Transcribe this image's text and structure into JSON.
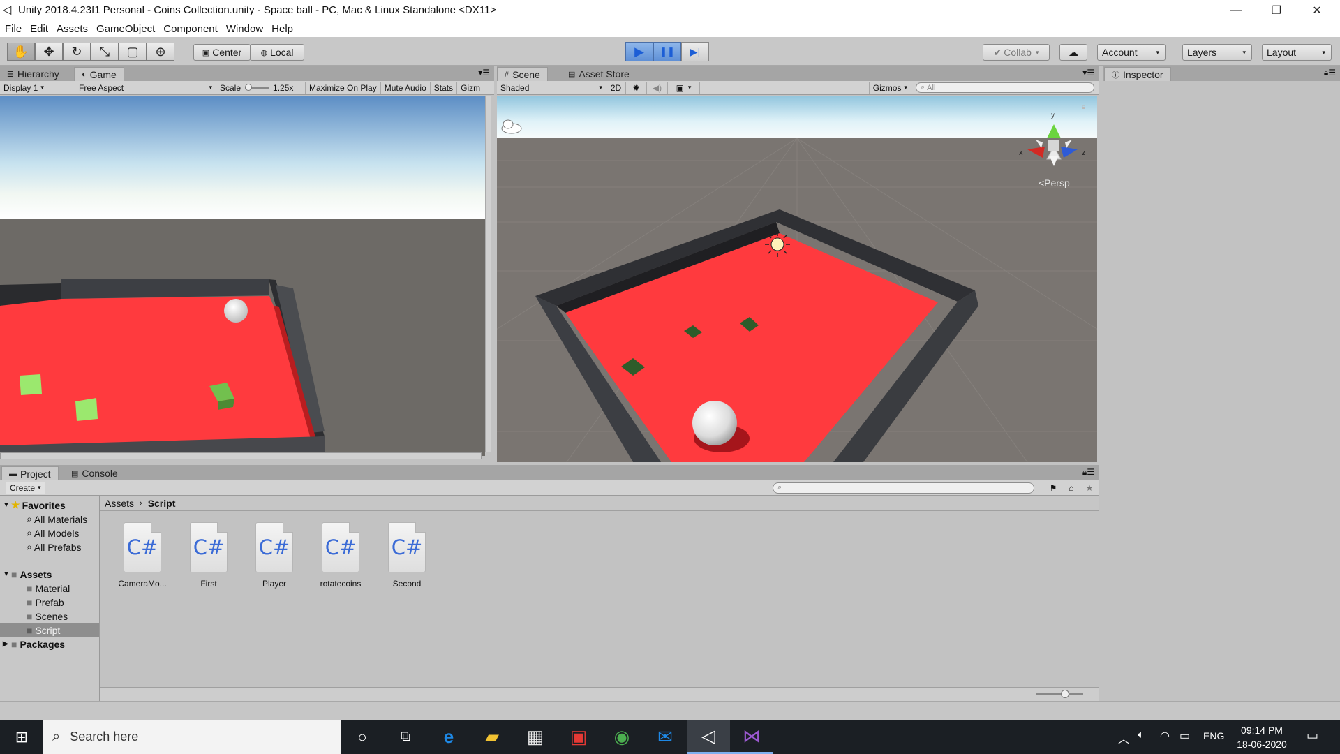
{
  "window": {
    "title": "Unity 2018.4.23f1 Personal - Coins Collection.unity - Space ball - PC, Mac & Linux Standalone <DX11>",
    "min": "—",
    "max": "❐",
    "close": "✕"
  },
  "menu": [
    "File",
    "Edit",
    "Assets",
    "GameObject",
    "Component",
    "Window",
    "Help"
  ],
  "toolbar": {
    "tools": [
      "hand-icon",
      "move-icon",
      "rotate-icon",
      "scale-icon",
      "rect-icon",
      "transform-icon"
    ],
    "tool_glyphs": [
      "✋",
      "✥",
      "↻",
      "⤡",
      "▢",
      "⊕"
    ],
    "pivot": "Center",
    "space": "Local",
    "play_glyph": "▶",
    "pause_glyph": "❚❚",
    "step_glyph": "▶|",
    "collab": "Collab",
    "cloud_glyph": "☁",
    "account": "Account",
    "layers": "Layers",
    "layout": "Layout"
  },
  "left_panel": {
    "tabs": [
      "Hierarchy",
      "Game"
    ],
    "display": "Display 1",
    "aspect": "Free Aspect",
    "scale_label": "Scale",
    "scale_value": "1.25x",
    "maximize": "Maximize On Play",
    "mute": "Mute Audio",
    "stats": "Stats",
    "gizmos_cut": "Gizm"
  },
  "scene_panel": {
    "tabs": [
      "Scene",
      "Asset Store"
    ],
    "shading": "Shaded",
    "mode2d": "2D",
    "gizmos": "Gizmos",
    "search_placeholder": "All",
    "persp": "<Persp",
    "axis_x": "x",
    "axis_y": "y",
    "axis_z": "z"
  },
  "inspector": {
    "tab": "Inspector"
  },
  "project": {
    "tabs": [
      "Project",
      "Console"
    ],
    "create": "Create",
    "favorites": "Favorites",
    "fav_items": [
      "All Materials",
      "All Models",
      "All Prefabs"
    ],
    "assets_root": "Assets",
    "folders": [
      "Material",
      "Prefab",
      "Scenes",
      "Script"
    ],
    "selected_folder": "Script",
    "packages": "Packages",
    "breadcrumb": [
      "Assets",
      "Script"
    ],
    "files": [
      {
        "icon": "C#",
        "name": "CameraMo..."
      },
      {
        "icon": "C#",
        "name": "First"
      },
      {
        "icon": "C#",
        "name": "Player"
      },
      {
        "icon": "C#",
        "name": "rotatecoins"
      },
      {
        "icon": "C#",
        "name": "Second"
      }
    ]
  },
  "taskbar": {
    "search_placeholder": "Search here",
    "lang": "ENG",
    "time": "09:14 PM",
    "date": "18-06-2020"
  },
  "colors": {
    "floor": "#ff3a3e",
    "wall": "#3b3d42",
    "sky": "#dff2f8",
    "ground": "#6e6a66",
    "coin_game": "#9be86e",
    "coin_scene": "#2e5c2a",
    "play_blue": "#5f90d6"
  }
}
